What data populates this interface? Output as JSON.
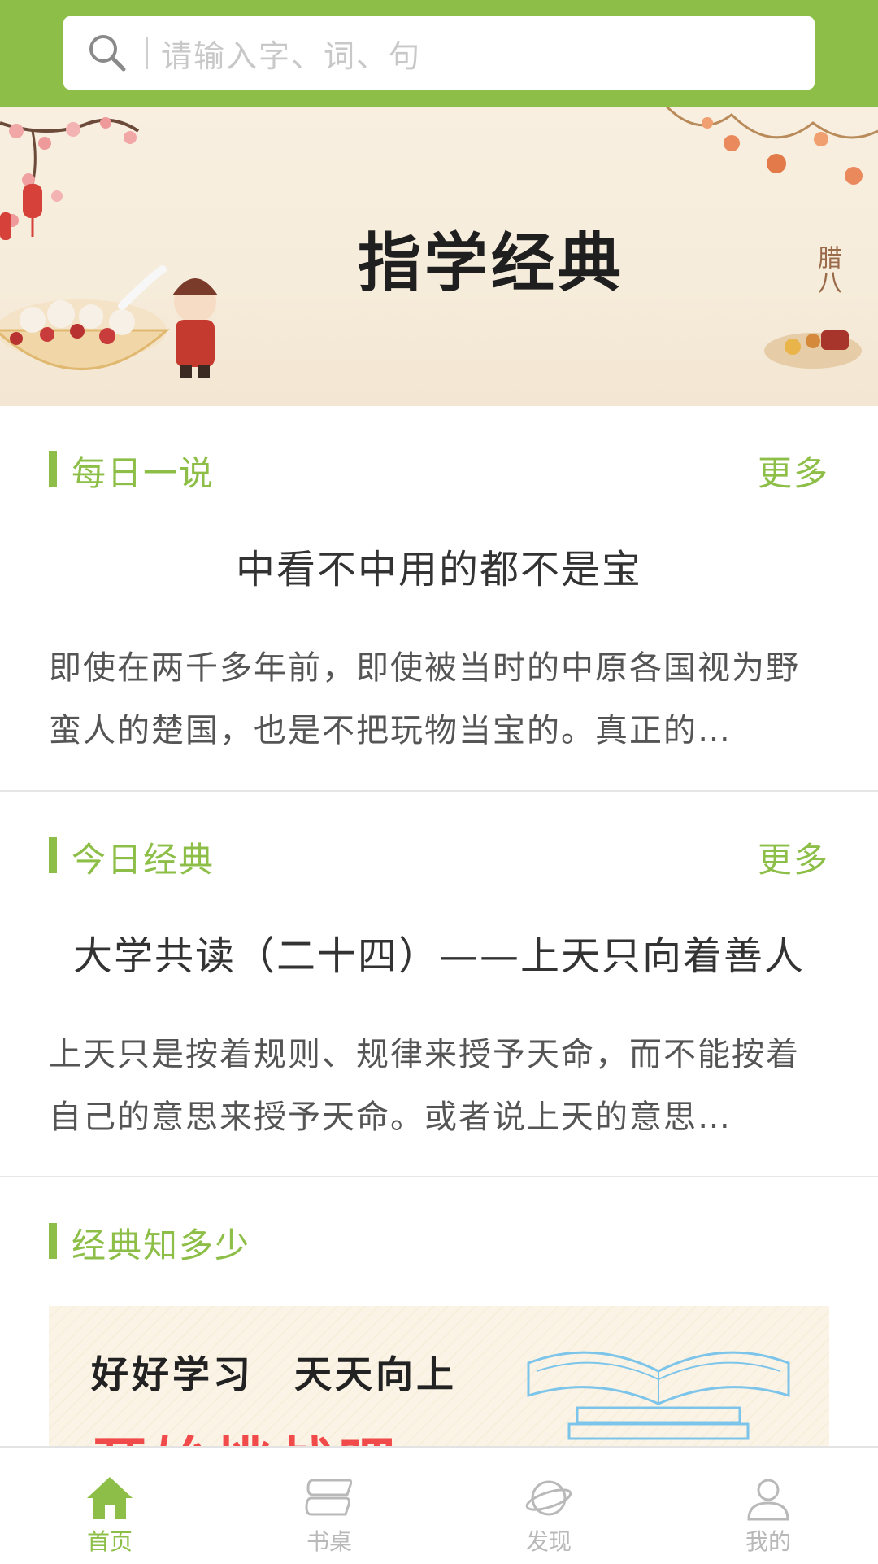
{
  "search": {
    "placeholder": "请输入字、词、句"
  },
  "banner": {
    "title": "指学经典",
    "side_text": "腊八"
  },
  "daily_saying": {
    "section_title": "每日一说",
    "more_label": "更多",
    "article_title": "中看不中用的都不是宝",
    "summary": "即使在两千多年前，即使被当时的中原各国视为野蛮人的楚国，也是不把玩物当宝的。真正的…"
  },
  "today_classic": {
    "section_title": "今日经典",
    "more_label": "更多",
    "article_title": "大学共读（二十四）——上天只向着善人",
    "summary": "上天只是按着规则、规律来授予天命，而不能按着自己的意思来授予天命。或者说上天的意思…"
  },
  "quiz": {
    "section_title": "经典知多少",
    "slogan": "好好学习　天天向上",
    "cta": "开始挑战吧"
  },
  "tabbar": {
    "active": "home",
    "items": [
      {
        "id": "home",
        "label": "首页",
        "icon": "home-icon"
      },
      {
        "id": "desk",
        "label": "书桌",
        "icon": "book-icon"
      },
      {
        "id": "discover",
        "label": "发现",
        "icon": "planet-icon"
      },
      {
        "id": "mine",
        "label": "我的",
        "icon": "user-icon"
      }
    ]
  },
  "colors": {
    "accent": "#8dbf48",
    "tab_inactive": "#b9b9b9",
    "cta_red": "#f04a4a"
  }
}
